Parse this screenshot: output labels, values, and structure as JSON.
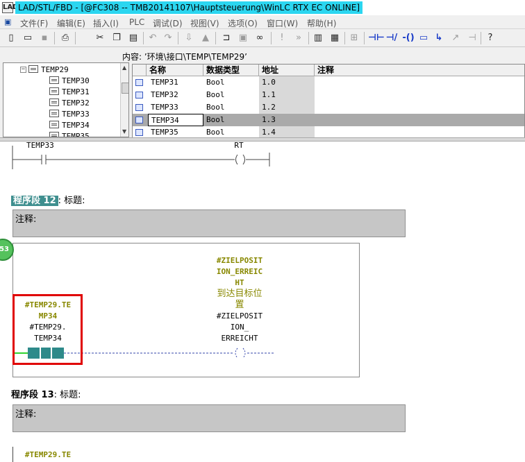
{
  "window": {
    "app_icon": "LAD",
    "title": "LAD/STL/FBD  - [@FC308 -- TMB20141107\\Hauptsteuerung\\WinLC RTX EC  ONLINE]"
  },
  "menu": {
    "doc_icon": "document-icon",
    "items": [
      "文件(F)",
      "编辑(E)",
      "插入(I)",
      "PLC",
      "调试(D)",
      "视图(V)",
      "选项(O)",
      "窗口(W)",
      "帮助(H)"
    ]
  },
  "toolbar": {
    "buttons": [
      "new-icon",
      "open-icon",
      "save-icon",
      "print-icon",
      "cut-icon",
      "copy-icon",
      "paste-icon",
      "undo-icon",
      "redo-icon",
      "download-icon",
      "monitor-icon",
      "glasses-icon",
      "toggle-comment-icon",
      "overview-icon",
      "zoom-icon",
      "normally-open-contact-icon",
      "normally-closed-contact-icon",
      "coil-icon",
      "branch-open-icon",
      "branch-close-icon",
      "connection-icon",
      "help-pointer-icon"
    ]
  },
  "interface": {
    "content_label": "内容: ’环境\\接口\\TEMP\\TEMP29’",
    "tree": {
      "parent": "TEMP29",
      "items": [
        "TEMP30",
        "TEMP31",
        "TEMP32",
        "TEMP33",
        "TEMP34",
        "TEMP35"
      ]
    },
    "columns": {
      "name": "名称",
      "type": "数据类型",
      "address": "地址",
      "comment": "注释"
    },
    "rows": [
      {
        "name": "TEMP31",
        "type": "Bool",
        "address": "1.0"
      },
      {
        "name": "TEMP32",
        "type": "Bool",
        "address": "1.1"
      },
      {
        "name": "TEMP33",
        "type": "Bool",
        "address": "1.2"
      },
      {
        "name": "TEMP34",
        "type": "Bool",
        "address": "1.3"
      },
      {
        "name": "TEMP35",
        "type": "Bool",
        "address": "1.4"
      }
    ]
  },
  "editor": {
    "prev_network": {
      "contact_label": "TEMP33",
      "coil_label": "RT"
    },
    "network12": {
      "prefix": "程序段",
      "number": "12",
      "title_label": ": 标题:",
      "comment": "注释:",
      "badge": "53",
      "coil_symbol": "#ZIELPOSITION_ERREICHT",
      "coil_symbol_lines": [
        "#ZIELPOSIT",
        "ION_ERREIC",
        "HT"
      ],
      "coil_comment_lines": [
        "到达目标位",
        "置"
      ],
      "coil_operand_lines": [
        "#ZIELPOSIT",
        "ION_",
        "ERREICHT"
      ],
      "contact_symbol_lines": [
        "#TEMP29.TE",
        "MP34"
      ],
      "contact_operand_lines": [
        "#TEMP29.",
        "TEMP34"
      ]
    },
    "network13": {
      "prefix": "程序段",
      "number": "13",
      "title_label": ": 标题:",
      "comment": "注释:",
      "contact_symbol": "#TEMP29.TE"
    }
  }
}
